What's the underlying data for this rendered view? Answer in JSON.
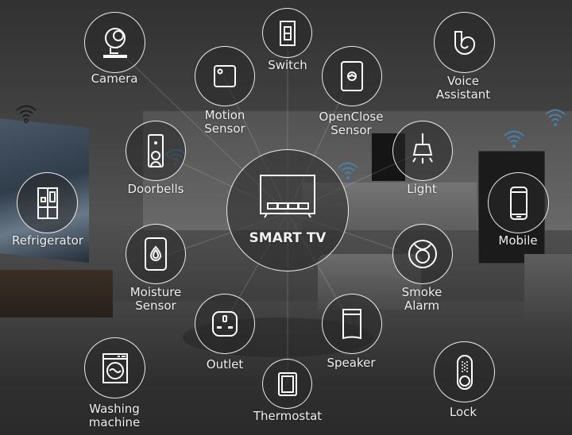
{
  "hub": {
    "label": "SMART TV",
    "icon": "smart-tv-icon"
  },
  "devices": [
    {
      "id": "camera",
      "label": "Camera",
      "icon": "camera-icon"
    },
    {
      "id": "switch",
      "label": "Switch",
      "icon": "switch-icon"
    },
    {
      "id": "motion",
      "label_line1": "Motion",
      "label_line2": "Sensor",
      "icon": "motion-sensor-icon"
    },
    {
      "id": "openclose",
      "label_line1": "OpenClose",
      "label_line2": "Sensor",
      "icon": "open-close-sensor-icon"
    },
    {
      "id": "voice",
      "label_line1": "Voice",
      "label_line2": "Assistant",
      "icon": "voice-assistant-icon"
    },
    {
      "id": "doorbells",
      "label": "Doorbells",
      "icon": "doorbell-icon"
    },
    {
      "id": "light",
      "label": "Light",
      "icon": "light-icon"
    },
    {
      "id": "refrigerator",
      "label": "Refrigerator",
      "icon": "refrigerator-icon"
    },
    {
      "id": "mobile",
      "label": "Mobile",
      "icon": "mobile-icon"
    },
    {
      "id": "moisture",
      "label_line1": "Moisture",
      "label_line2": "Sensor",
      "icon": "moisture-sensor-icon"
    },
    {
      "id": "smoke",
      "label_line1": "Smoke",
      "label_line2": "Alarm",
      "icon": "smoke-alarm-icon"
    },
    {
      "id": "outlet",
      "label": "Outlet",
      "icon": "outlet-icon"
    },
    {
      "id": "speaker",
      "label": "Speaker",
      "icon": "speaker-icon"
    },
    {
      "id": "washing",
      "label_line1": "Washing",
      "label_line2": "machine",
      "icon": "washing-machine-icon"
    },
    {
      "id": "thermostat",
      "label": "Thermostat",
      "icon": "thermostat-icon"
    },
    {
      "id": "lock",
      "label": "Lock",
      "icon": "lock-icon"
    }
  ],
  "colors": {
    "line": "#ffffff",
    "wifi": "#4a7fa8"
  }
}
